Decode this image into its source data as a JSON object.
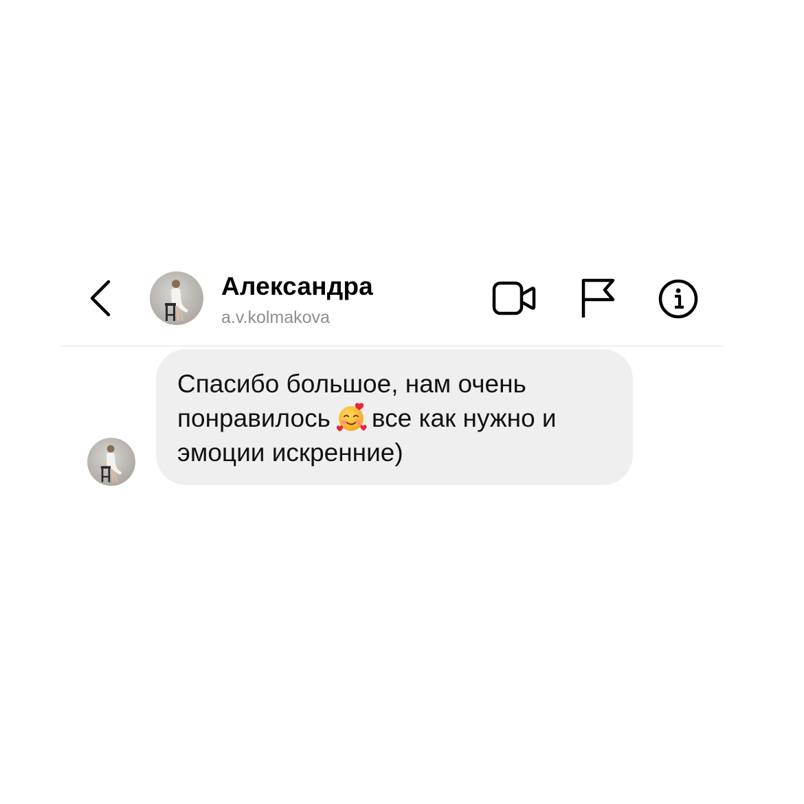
{
  "header": {
    "name": "Александра",
    "username": "a.v.kolmakova",
    "icons": {
      "back": "chevron-left-icon",
      "video": "video-camera-icon",
      "flag": "flag-icon",
      "info": "info-icon"
    }
  },
  "message": {
    "text_before": "Спасибо большое, нам очень\nпонравилось",
    "emoji": "smiling-face-with-hearts-icon",
    "text_after": "все как нужно и\nэмоции искренние)"
  },
  "colors": {
    "bubble": "#efefef",
    "username": "#8e8e8e",
    "divider": "#e3e3e3",
    "icon": "#000000"
  }
}
